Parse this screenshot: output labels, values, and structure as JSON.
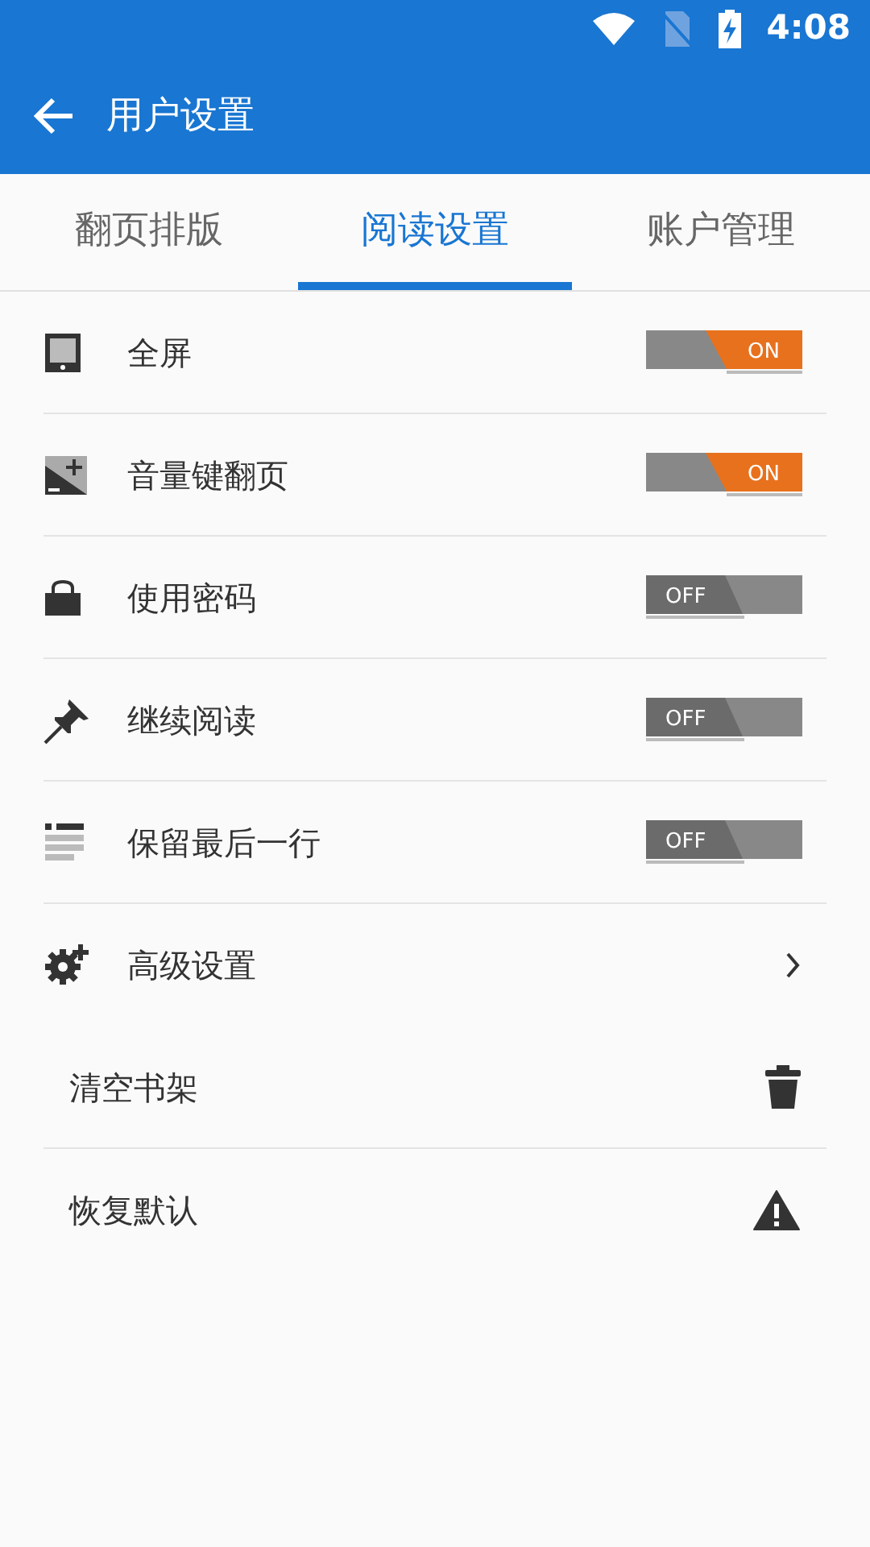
{
  "status_bar": {
    "time": "4:08"
  },
  "app_bar": {
    "title": "用户设置"
  },
  "tabs": [
    {
      "label": "翻页排版",
      "selected": false
    },
    {
      "label": "阅读设置",
      "selected": true
    },
    {
      "label": "账户管理",
      "selected": false
    }
  ],
  "settings": [
    {
      "kind": "toggle",
      "label": "全屏",
      "on": true,
      "switch_label": "ON"
    },
    {
      "kind": "toggle",
      "label": "音量键翻页",
      "on": true,
      "switch_label": "ON"
    },
    {
      "kind": "toggle",
      "label": "使用密码",
      "on": false,
      "switch_label": "OFF"
    },
    {
      "kind": "toggle",
      "label": "继续阅读",
      "on": false,
      "switch_label": "OFF"
    },
    {
      "kind": "toggle",
      "label": "保留最后一行",
      "on": false,
      "switch_label": "OFF"
    },
    {
      "kind": "link",
      "label": "高级设置"
    },
    {
      "kind": "action",
      "label": "清空书架"
    },
    {
      "kind": "action",
      "label": "恢复默认"
    }
  ]
}
